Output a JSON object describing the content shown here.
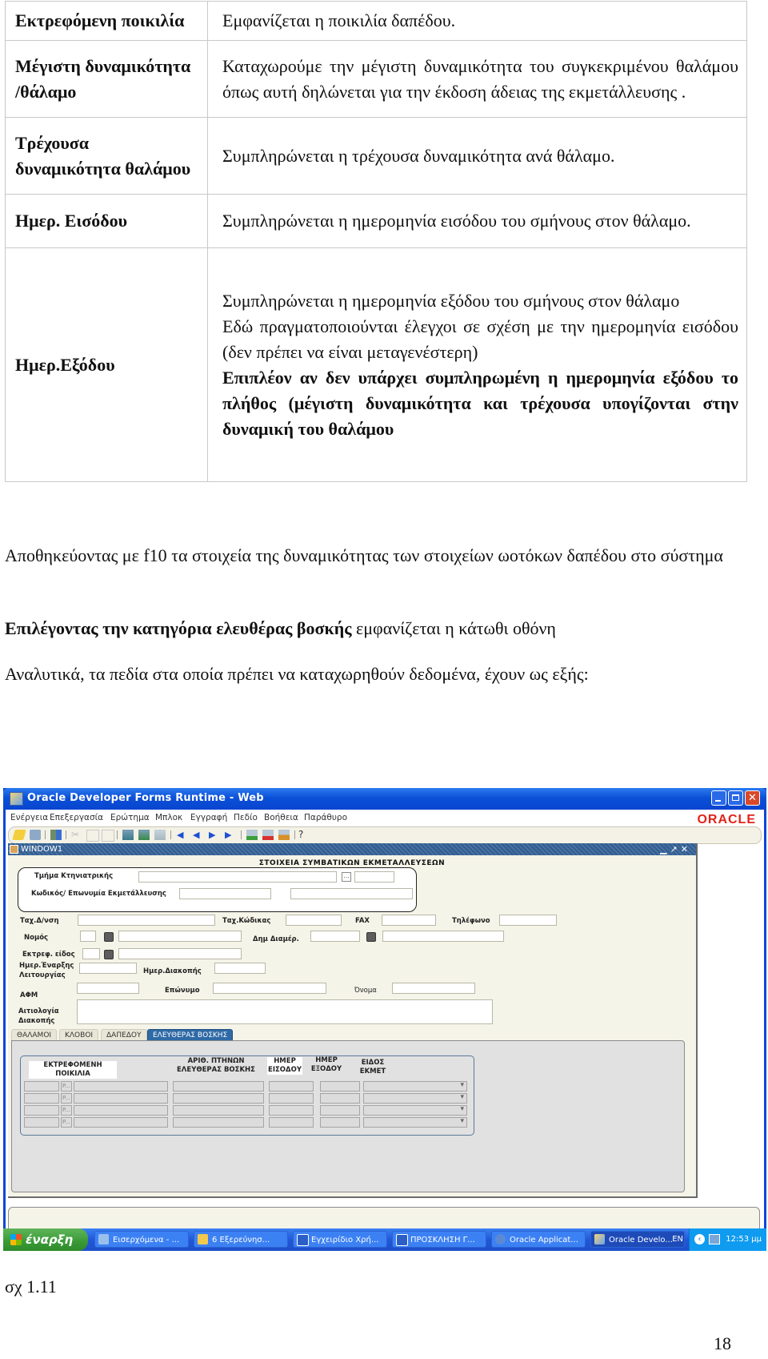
{
  "definitions": [
    {
      "term": "Εκτρεφόμενη ποικιλία",
      "description": [
        "Εμφανίζεται η ποικιλία  δαπέδου."
      ]
    },
    {
      "term": "Μέγιστη δυναμικότητα /θάλαμο",
      "description": [
        "Καταχωρούμε την μέγιστη δυναμικότητα του συγκεκριμένου θαλάμου όπως αυτή δηλώνεται για την έκδοση άδειας της εκμετάλλευσης ."
      ]
    },
    {
      "term": "Τρέχουσα δυναμικότητα θαλάμου",
      "description": [
        "Συμπληρώνεται η τρέχουσα δυναμικότητα ανά θάλαμο."
      ]
    },
    {
      "term": "Ημερ. Εισόδου",
      "description": [
        "Συμπληρώνεται η ημερομηνία εισόδου του σμήνους στον θάλαμο."
      ]
    },
    {
      "term": "Ημερ.Εξόδου",
      "description": [
        "Συμπληρώνεται η ημερομηνία εξόδου του σμήνους στον θάλαμο",
        "Εδώ πραγματοποιούνται έλεγχοι σε σχέση με την ημερομηνία εισόδου (δεν πρέπει να είναι μεταγενέστερη)"
      ],
      "bold_note": "Επιπλέον αν δεν υπάρχει συμπληρωμένη η ημερομηνία εξόδου  το πλήθος (μέγιστη δυναμικότητα και τρέχουσα υπογίζονται στην δυναμική του θαλάμου"
    }
  ],
  "paragraphs": {
    "save_note": "Αποθηκεύοντας με f10 τα στοιχεία της δυναμικότητας  των στοιχείων ωοτόκων δαπέδου στο σύστημα",
    "select_bold": "Επιλέγοντας την κατηγόρια ελευθέρας βοσκής",
    "select_rest": " εμφανίζεται η κάτωθι οθόνη",
    "fields_intro": "Αναλυτικά, τα πεδία στα οποία πρέπει να καταχωρηθούν δεδομένα, έχουν ως εξής:"
  },
  "screenshot": {
    "window_title": "Oracle Developer Forms Runtime - Web",
    "brand": "ORACLE",
    "menu": [
      "Ενέργεια",
      "Επεξεργασία",
      "Ερώτημα",
      "Μπλοκ",
      "Εγγραφή",
      "Πεδίο",
      "Βοήθεια",
      "Παράθυρο"
    ],
    "toolbar_icons": [
      "save-icon",
      "print-icon",
      "exit-icon",
      "cut-icon",
      "copy-icon",
      "paste-icon",
      "enter-query-icon",
      "execute-query-icon",
      "cancel-query-icon",
      "first-record-icon",
      "previous-record-icon",
      "next-record-icon",
      "last-record-icon",
      "insert-record-icon",
      "delete-record-icon",
      "lock-record-icon",
      "help-icon"
    ],
    "inner_window_title": "WINDOW1",
    "form_title": "ΣΤΟΙΧΕΙΑ ΣΥΜΒΑΤΙΚΩΝ ΕΚΜΕΤΑΛΛΕΥΣΕΩΝ",
    "labels": {
      "vet_dept": "Τμήμα Κτηνιατρικής",
      "farm_code": "Κωδικός/ Επωνυμία Εκμετάλλευσης",
      "postal_address": "Ταχ.Δ/νση",
      "postal_code": "Ταχ.Κώδικας",
      "fax": "FAX",
      "phone": "Τηλέφωνο",
      "prefecture": "Νομός",
      "municipality": "Δημ Διαμέρ.",
      "breed_type": "Εκτρεφ. είδος",
      "start_date_1": "Ημερ.Έναρξης",
      "start_date_2": "Λειτουργίας",
      "stop_date": "Ημερ.Διακοπής",
      "afm": "ΑΦΜ",
      "surname": "Επώνυμο",
      "name": "Όνομα",
      "reason_1": "Αιτιολογία",
      "reason_2": "Διακοπής"
    },
    "tabs": [
      {
        "label": "ΘΑΛΑΜΟΙ",
        "active": false
      },
      {
        "label": "ΚΛΟΒΟΙ",
        "active": false
      },
      {
        "label": "ΔΑΠΕΔΟΥ",
        "active": false
      },
      {
        "label": "ΕΛΕΥΘΕΡΑΣ ΒΟΣΚΗΣ",
        "active": true
      }
    ],
    "grid": {
      "headers": [
        "ΕΚΤΡΕΦΟΜΕΝΗ ΠΟΙΚΙΛΙΑ",
        "ΑΡΙΘ.  ΠΤΗΝΩΝ ΕΛΕΥΘΕΡΑΣ ΒΟΣΚΗΣ",
        "ΗΜΕΡ ΕΙΣΟΔΟΥ",
        "ΗΜΕΡ ΕΞΟΔΟΥ",
        "ΕΙΔΟΣ ΕΚΜΕΤ"
      ],
      "row_count": 4,
      "lov_button_label": "P..."
    },
    "taskbar": {
      "start": "έναρξη",
      "tasks": [
        {
          "label": "Εισερχόμενα - ...",
          "active": false,
          "icon": "outlook-icon"
        },
        {
          "label": "6 Εξερεύνησ...",
          "active": false,
          "icon": "folder-icon"
        },
        {
          "label": "Εγχειρίδιο Χρή...",
          "active": false,
          "icon": "word-icon"
        },
        {
          "label": "ΠΡΟΣΚΛΗΣΗ Γ...",
          "active": false,
          "icon": "word-icon"
        },
        {
          "label": "Oracle Applicat...",
          "active": false,
          "icon": "browser-icon"
        },
        {
          "label": "Oracle Develo...",
          "active": true,
          "icon": "oracle-forms-icon"
        }
      ],
      "language": "EN",
      "clock": "12:53 μμ"
    }
  },
  "caption": "σχ 1.11",
  "page_number": "18"
}
